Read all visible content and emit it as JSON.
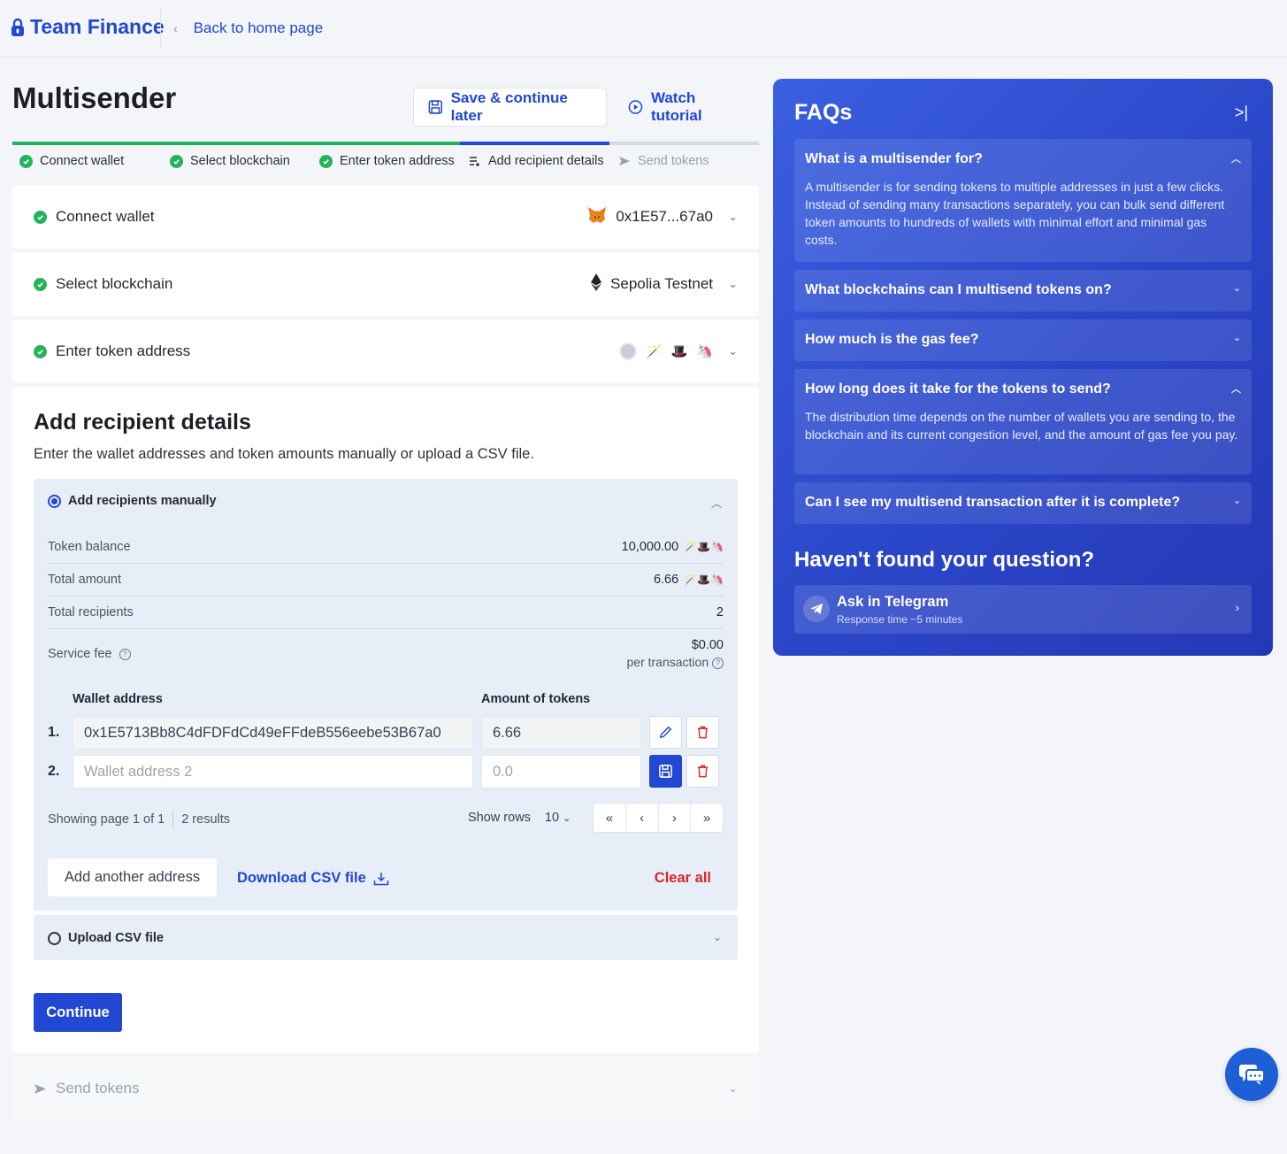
{
  "header": {
    "brand": "Team Finance",
    "back_label": "Back to home page"
  },
  "page": {
    "title": "Multisender",
    "save_label": "Save & continue later",
    "watch_label": "Watch tutorial"
  },
  "steps": [
    {
      "label": "Connect wallet",
      "state": "done"
    },
    {
      "label": "Select blockchain",
      "state": "done"
    },
    {
      "label": "Enter token address",
      "state": "done"
    },
    {
      "label": "Add recipient details",
      "state": "current"
    },
    {
      "label": "Send tokens",
      "state": "pending"
    }
  ],
  "sections": {
    "connect_wallet": {
      "label": "Connect wallet",
      "value": "0x1E57...67a0"
    },
    "select_blockchain": {
      "label": "Select blockchain",
      "value": "Sepolia Testnet"
    },
    "enter_token": {
      "label": "Enter token address"
    }
  },
  "recipients": {
    "title": "Add recipient details",
    "subtitle": "Enter the wallet addresses and token amounts manually or upload a CSV file.",
    "manual_label": "Add recipients manually",
    "stats": {
      "token_balance_label": "Token balance",
      "token_balance": "10,000.00",
      "total_amount_label": "Total amount",
      "total_amount": "6.66",
      "total_recipients_label": "Total recipients",
      "total_recipients": "2",
      "service_fee_label": "Service fee",
      "service_fee": "$0.00",
      "per_transaction": "per transaction"
    },
    "columns": {
      "wallet": "Wallet address",
      "amount": "Amount of tokens"
    },
    "rows": [
      {
        "num": "1.",
        "wallet": "0x1E5713Bb8C4dFDFdCd49eFFdeB556eebe53B67a0",
        "amount": "6.66"
      },
      {
        "num": "2.",
        "wallet_placeholder": "Wallet address 2",
        "amount_placeholder": "0.0"
      }
    ],
    "pager": {
      "showing": "Showing page 1 of 1",
      "results": "2 results",
      "show_rows": "Show rows",
      "rows_value": "10"
    },
    "add_another": "Add another address",
    "download_csv": "Download CSV file",
    "clear_all": "Clear all",
    "upload_csv": "Upload CSV file",
    "continue": "Continue"
  },
  "send_tokens": {
    "label": "Send tokens"
  },
  "faq": {
    "title": "FAQs",
    "items": [
      {
        "q": "What is a multisender for?",
        "a": "A multisender is for sending tokens to multiple addresses in just a few clicks. Instead of sending many transactions separately, you can bulk send different token amounts to hundreds of wallets with minimal effort and minimal gas costs."
      },
      {
        "q": "What blockchains can I multisend tokens on?"
      },
      {
        "q": "How much is the gas fee?"
      },
      {
        "q": "How long does it take for the tokens to send?",
        "a": "The distribution time depends on the number of wallets you are sending to, the blockchain and its current congestion level, and the amount of gas fee you pay."
      },
      {
        "q": "Can I see my multisend transaction after it is complete?"
      }
    ],
    "not_found": "Haven't found your question?",
    "telegram_title": "Ask in Telegram",
    "telegram_sub": "Response time ~5 minutes"
  },
  "colors": {
    "accent": "#2147d3",
    "success": "#23b35a",
    "danger": "#dc2626"
  }
}
